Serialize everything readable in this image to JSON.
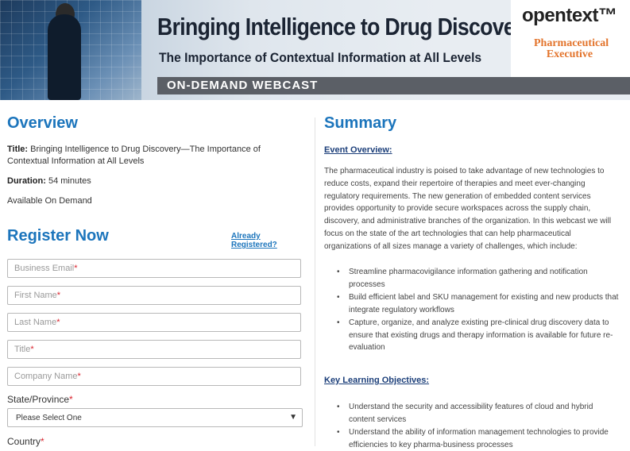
{
  "banner": {
    "title": "Bringing Intelligence to Drug Discovery",
    "subtitle": "The Importance of Contextual Information at All Levels",
    "strip": "ON-DEMAND WEBCAST",
    "logo1": "opentext™",
    "logo2": "Pharmaceutical Executive"
  },
  "overview": {
    "heading": "Overview",
    "title_label": "Title:",
    "title_value": "Bringing Intelligence to Drug Discovery—The Importance of Contextual Information at All Levels",
    "duration_label": "Duration:",
    "duration_value": "54 minutes",
    "availability": "Available On Demand"
  },
  "register": {
    "heading": "Register Now",
    "already": "Already Registered?",
    "fields": [
      {
        "label": "Business Email",
        "req": "*"
      },
      {
        "label": "First Name",
        "req": "*"
      },
      {
        "label": "Last Name",
        "req": "*"
      },
      {
        "label": "Title",
        "req": "*"
      },
      {
        "label": "Company Name",
        "req": "*"
      }
    ],
    "state_label": "State/Province",
    "state_req": "*",
    "state_value": "Please Select One",
    "country_label": "Country",
    "country_req": "*"
  },
  "summary": {
    "heading": "Summary",
    "event_overview": "Event Overview:",
    "paragraph": "The pharmaceutical industry is poised to take advantage of new technologies to reduce costs, expand their repertoire of therapies and meet ever-changing regulatory requirements. The new generation of embedded content services provides opportunity to provide secure workspaces across the supply chain, discovery, and administrative branches of the organization. In this webcast we will focus on the state of the art technologies that can help pharmaceutical organizations of all sizes manage a variety of challenges, which include:",
    "bullets": [
      "Streamline pharmacovigilance information gathering and notification processes",
      "Build efficient label and SKU management for existing and new products that integrate regulatory workflows",
      "Capture, organize, and analyze existing pre-clinical drug discovery data to ensure that existing drugs and therapy information is available for future re-evaluation"
    ],
    "key_objectives": "Key Learning Objectives:",
    "objectives": [
      "Understand the security and accessibility features of cloud and hybrid content services",
      "Understand the ability of information management technologies to provide efficiencies to key pharma-business processes"
    ]
  },
  "colors": {
    "accent": "#1c75bc",
    "required": "#d9232d",
    "logo_orange": "#e3742c"
  }
}
